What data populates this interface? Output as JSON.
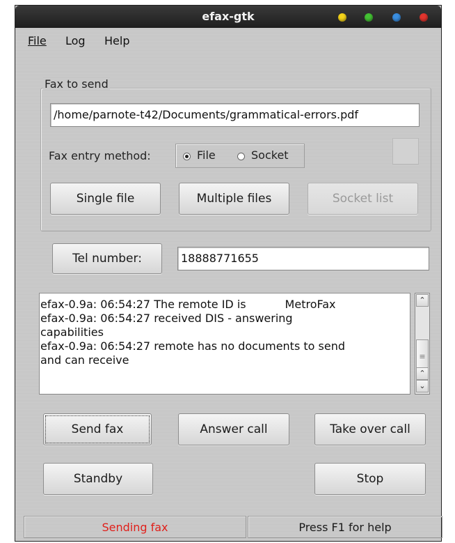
{
  "window": {
    "title": "efax-gtk",
    "title_buttons": [
      {
        "name": "minimize",
        "color": "#f4d31a"
      },
      {
        "name": "maximize",
        "color": "#44c234"
      },
      {
        "name": "shade",
        "color": "#3a8ee0"
      },
      {
        "name": "close",
        "color": "#e2352e"
      }
    ]
  },
  "menu": {
    "file": "File",
    "log": "Log",
    "help": "Help"
  },
  "fax_group": {
    "title": "Fax to send",
    "file_path": "/home/parnote-t42/Documents/grammatical-errors.pdf",
    "entry_method_label": "Fax entry method:",
    "radio_file": "File",
    "radio_socket": "Socket",
    "selected_method": "File",
    "single_file": "Single file",
    "multiple_files": "Multiple files",
    "socket_list": "Socket list"
  },
  "tel": {
    "button": "Tel number:",
    "value": "18888771655"
  },
  "log_lines": [
    "efax-0.9a: 06:54:27 The remote ID is           MetroFax",
    "efax-0.9a: 06:54:27 received DIS - answering",
    "capabilities",
    "efax-0.9a: 06:54:27 remote has no documents to send",
    "and can receive"
  ],
  "actions": {
    "send_fax": "Send fax",
    "answer_call": "Answer call",
    "take_over_call": "Take over call",
    "standby": "Standby",
    "stop": "Stop"
  },
  "status": {
    "left": "Sending fax",
    "left_color": "#e0201b",
    "right": "Press F1 for help"
  }
}
